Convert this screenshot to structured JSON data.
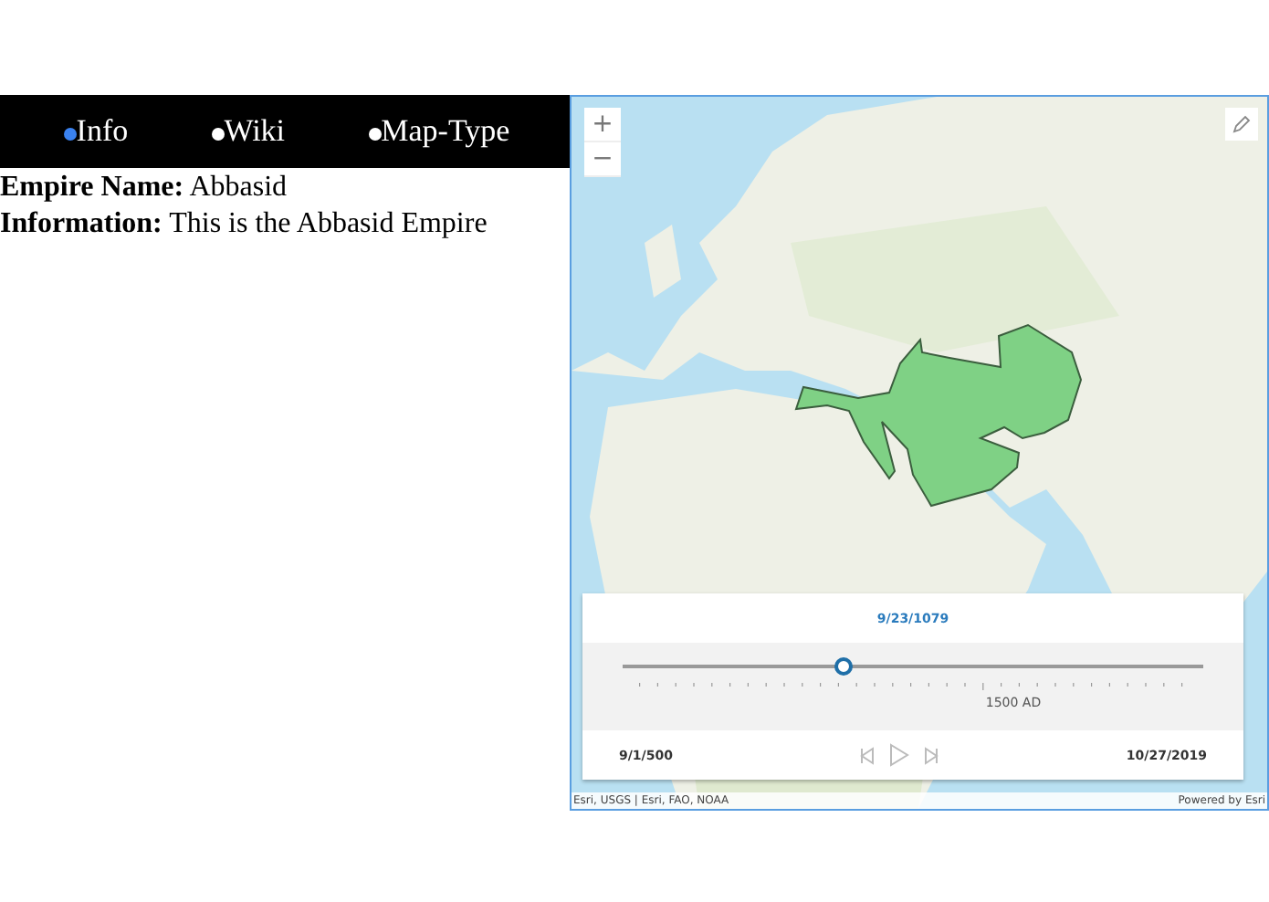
{
  "tabs": [
    {
      "label": "Info",
      "selected": true
    },
    {
      "label": "Wiki",
      "selected": false
    },
    {
      "label": "Map-Type",
      "selected": false
    }
  ],
  "info": [
    {
      "label": "Empire Name:",
      "value": "Abbasid"
    },
    {
      "label": "Information:",
      "value": "This is the Abbasid Empire"
    }
  ],
  "map": {
    "zoom_buttons": [
      "+",
      "−"
    ],
    "attribution": "Esri, USGS | Esri, FAO, NOAA",
    "powered_by": "Powered by Esri"
  },
  "time_slider": {
    "current": "9/23/1079",
    "level": 0.38,
    "tick_label": "1500 AD",
    "start": "9/1/500",
    "end": "10/27/2019"
  }
}
